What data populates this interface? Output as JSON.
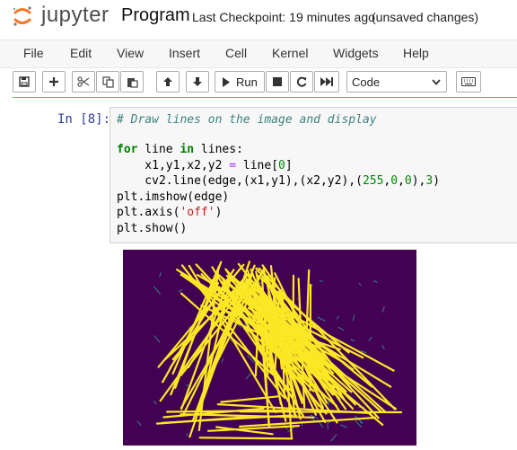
{
  "header": {
    "brand": "jupyter",
    "notebook_title": "Program",
    "checkpoint": "Last Checkpoint: 19 minutes ago",
    "unsaved": "(unsaved changes)"
  },
  "menu": [
    "File",
    "Edit",
    "View",
    "Insert",
    "Cell",
    "Kernel",
    "Widgets",
    "Help"
  ],
  "toolbar": {
    "run_label": "Run",
    "cell_type": "Code",
    "icons": [
      "save-icon",
      "plus-icon",
      "cut-icon",
      "copy-icon",
      "paste-icon",
      "arrow-up-icon",
      "arrow-down-icon",
      "run-icon",
      "stop-icon",
      "restart-icon",
      "fast-forward-icon",
      "keyboard-icon"
    ]
  },
  "cell": {
    "prompt": "In [8]:",
    "code": {
      "line1_comment": "# Draw lines on the image and display",
      "line3_kw1": "for",
      "line3_a": " line ",
      "line3_kw2": "in",
      "line3_b": " lines:",
      "line4_a": "    x1,y1,x2,y2 ",
      "line4_op": "=",
      "line4_b": " line[",
      "line4_num": "0",
      "line4_c": "]",
      "line5_a": "    cv2.line(edge,(x1,y1),(x2,y2),(",
      "line5_n1": "255",
      "line5_s1": ",",
      "line5_n2": "0",
      "line5_s2": ",",
      "line5_n3": "0",
      "line5_s3": "),",
      "line5_n4": "3",
      "line5_end": ")",
      "line6": "plt.imshow(edge)",
      "line7_a": "plt.axis(",
      "line7_str": "'off'",
      "line7_b": ")",
      "line8": "plt.show()"
    }
  },
  "colors": {
    "image_bg": "#440154",
    "line_color": "#fde725",
    "edge_color": "#2a9d8f",
    "prompt_color": "#303f9f"
  }
}
